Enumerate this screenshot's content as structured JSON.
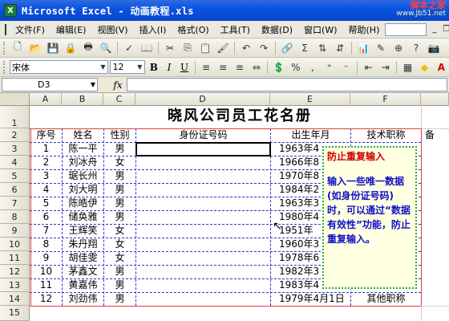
{
  "window": {
    "title": "Microsoft Excel - 动画教程.xls",
    "watermark_line1": "脚本之家",
    "watermark_line2": "www.Jb51.net"
  },
  "menu": {
    "items": [
      "文件(F)",
      "编辑(E)",
      "视图(V)",
      "插入(I)",
      "格式(O)",
      "工具(T)",
      "数据(D)",
      "窗口(W)",
      "帮助(H)"
    ]
  },
  "toolbar_format": {
    "font_name": "宋体",
    "font_size": "12",
    "bold": "B",
    "italic": "I",
    "underline": "U"
  },
  "formula_bar": {
    "name_box": "D3",
    "fx_label": "fx",
    "formula": ""
  },
  "columns": [
    "A",
    "B",
    "C",
    "D",
    "E",
    "F",
    ""
  ],
  "rows": [
    "1",
    "2",
    "3",
    "4",
    "5",
    "6",
    "7",
    "8",
    "9",
    "10",
    "11",
    "12",
    "13",
    "14",
    "15"
  ],
  "sheet": {
    "title": "晓风公司员工花名册",
    "headers": {
      "no": "序号",
      "name": "姓名",
      "gender": "性别",
      "id": "身份证号码",
      "birth": "出生年月",
      "title": "技术职称",
      "extra": "备"
    },
    "records": [
      {
        "no": "1",
        "name": "陈一平",
        "gender": "男",
        "birth": "1963年4"
      },
      {
        "no": "2",
        "name": "刘冰舟",
        "gender": "女",
        "birth": "1966年8"
      },
      {
        "no": "3",
        "name": "琚长州",
        "gender": "男",
        "birth": "1970年8"
      },
      {
        "no": "4",
        "name": "刘大明",
        "gender": "男",
        "birth": "1984年2"
      },
      {
        "no": "5",
        "name": "陈皓伊",
        "gender": "男",
        "birth": "1963年3"
      },
      {
        "no": "6",
        "name": "储奂雅",
        "gender": "男",
        "birth": "1980年4"
      },
      {
        "no": "7",
        "name": "王辉笑",
        "gender": "女",
        "birth": "1951年"
      },
      {
        "no": "8",
        "name": "朱丹翔",
        "gender": "女",
        "birth": "1960年3"
      },
      {
        "no": "9",
        "name": "胡佳雯",
        "gender": "女",
        "birth": "1978年6"
      },
      {
        "no": "10",
        "name": "茅鑫文",
        "gender": "男",
        "birth": "1982年3"
      },
      {
        "no": "11",
        "name": "黄嘉伟",
        "gender": "男",
        "birth": "1983年4"
      },
      {
        "no": "12",
        "name": "刘劲伟",
        "gender": "男",
        "birth": "1979年4月1日",
        "title": "其他职称"
      }
    ]
  },
  "tip": {
    "title": "防止重复输入",
    "body": "输入一些唯一数据(如身份证号码)时，可以通过“数据有效性”功能，防止重复输入。"
  },
  "colors": {
    "titlebar": "#0A54E3",
    "tip_title": "#D00000",
    "tip_body": "#1010C8",
    "tip_border": "#2AA84A",
    "print_border": "#E04040"
  }
}
